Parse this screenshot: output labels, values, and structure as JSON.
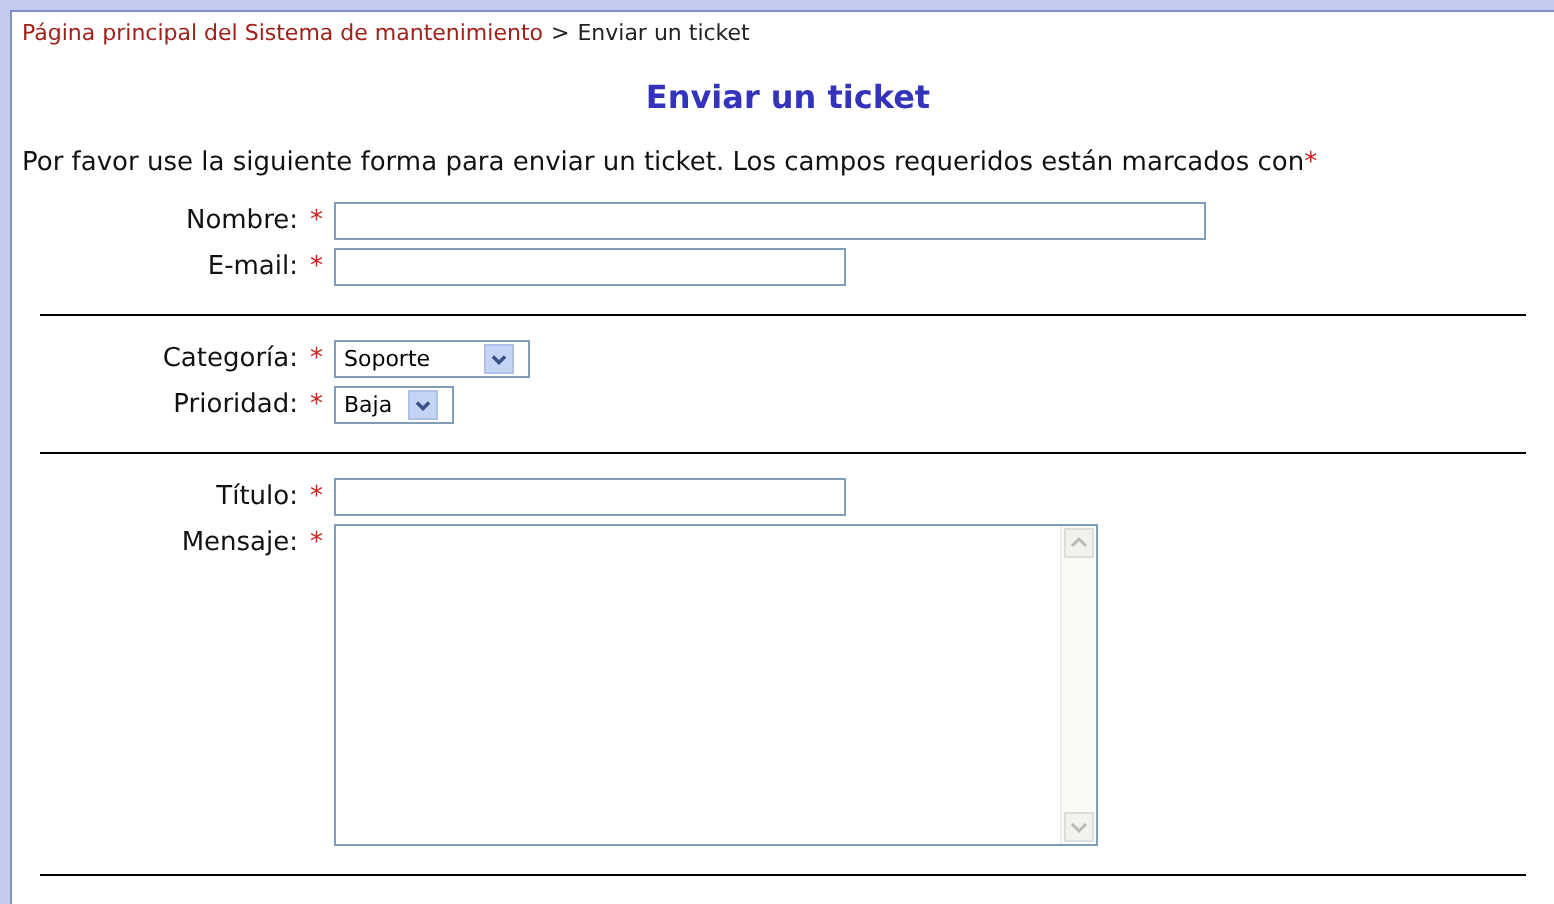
{
  "breadcrumb": {
    "home_link": "Página principal del Sistema de mantenimiento",
    "separator": ">",
    "current": "Enviar un ticket"
  },
  "title": "Enviar un ticket",
  "intro": {
    "text": "Por favor use la siguiente forma para enviar un ticket. Los campos requeridos están marcados con",
    "mark": "*"
  },
  "groups": [
    {
      "fields": [
        {
          "label": "Nombre:",
          "mark": "*",
          "kind": "wide"
        },
        {
          "label": "E-mail:",
          "mark": "*",
          "kind": "text"
        }
      ]
    },
    {
      "fields": [
        {
          "label": "Categoría:",
          "mark": "*",
          "kind": "select",
          "value": "Soporte"
        },
        {
          "label": "Prioridad:",
          "mark": "*",
          "kind": "select",
          "value": "Baja"
        }
      ]
    },
    {
      "fields": [
        {
          "label": "Título:",
          "mark": "*",
          "kind": "text"
        },
        {
          "label": "Mensaje:",
          "mark": "*",
          "kind": "textarea"
        }
      ]
    }
  ]
}
